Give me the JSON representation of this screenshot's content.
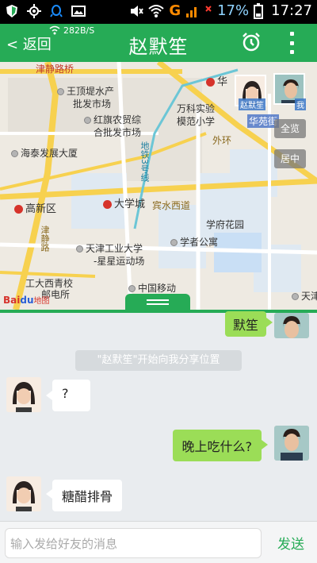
{
  "status_bar": {
    "battery_percent": "17%",
    "time": "17:27",
    "network_speed": "282B/S",
    "carrier_glyph": "G"
  },
  "header": {
    "back_label": "< 返回",
    "title": "赵默笙",
    "alarm_icon": "alarm-clock-icon",
    "more_icon": "vertical-dots-icon"
  },
  "map": {
    "labels": {
      "l1": "津静路桥",
      "l2": "王顶堤水产",
      "l3": "批发市场",
      "l4": "红旗农贸综",
      "l5": "合批发市场",
      "l6": "海泰发展大厦",
      "l7": "地铁3号线",
      "l8": "万科实验",
      "l9": "模范小学",
      "l10": "华苑街",
      "l11": "外环",
      "l12": "高新区",
      "l13": "大学城",
      "l14": "宾水西道",
      "l15": "学府花园",
      "l16": "学者公寓",
      "l17": "天津工业大学",
      "l18": "-星星运动场",
      "l19": "工大西青校",
      "l20": "中国移动",
      "l21": "天津",
      "l22": "华",
      "l23": "邮电所",
      "l24": "津静路"
    },
    "full_view_label": "全览",
    "reset_label": "居中",
    "friend_name": "赵默笙",
    "me_name": "我",
    "baidu_logo_a": "Bai",
    "baidu_logo_b": "du",
    "baidu_logo_c": "地图"
  },
  "chat": {
    "msg1_text": "默笙",
    "system_text": "\"赵默笙\"开始向我分享位置",
    "msg2_text": "?",
    "msg3_text": "晚上吃什么?",
    "msg4_text": "糖醋排骨"
  },
  "input": {
    "placeholder": "输入发给好友的消息",
    "send_label": "发送"
  },
  "colors": {
    "accent": "#26ab56",
    "bubble_self": "#9bdd57",
    "bubble_other": "#ffffff"
  }
}
